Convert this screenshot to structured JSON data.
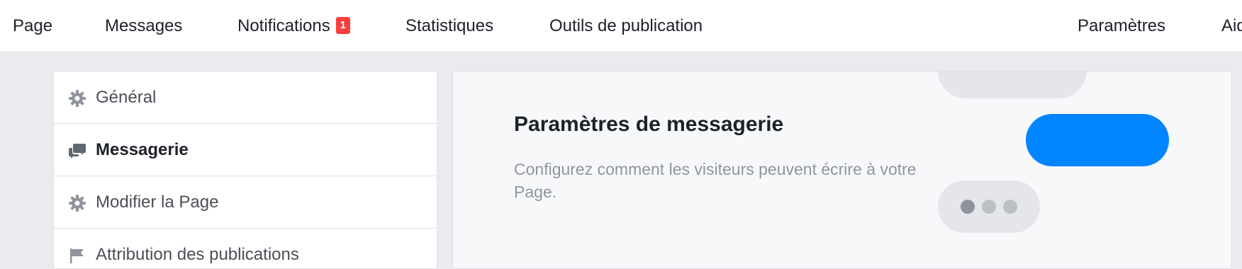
{
  "topnav": {
    "items": [
      {
        "label": "Page"
      },
      {
        "label": "Messages"
      },
      {
        "label": "Notifications",
        "badge": "1"
      },
      {
        "label": "Statistiques"
      },
      {
        "label": "Outils de publication"
      },
      {
        "label": "Paramètres"
      },
      {
        "label": "Aide"
      }
    ]
  },
  "sidebar": {
    "items": [
      {
        "label": "Général",
        "icon": "gear-icon"
      },
      {
        "label": "Messagerie",
        "icon": "chat-bubbles-icon",
        "active": true
      },
      {
        "label": "Modifier la Page",
        "icon": "gear-icon"
      },
      {
        "label": "Attribution des publications",
        "icon": "flag-icon"
      }
    ]
  },
  "main": {
    "title": "Paramètres de messagerie",
    "description": "Configurez comment les visiteurs peuvent écrire à votre Page."
  },
  "colors": {
    "accent_blue": "#0084ff",
    "bubble_gray": "#e4e6eb",
    "badge_red": "#fa3e3e"
  }
}
